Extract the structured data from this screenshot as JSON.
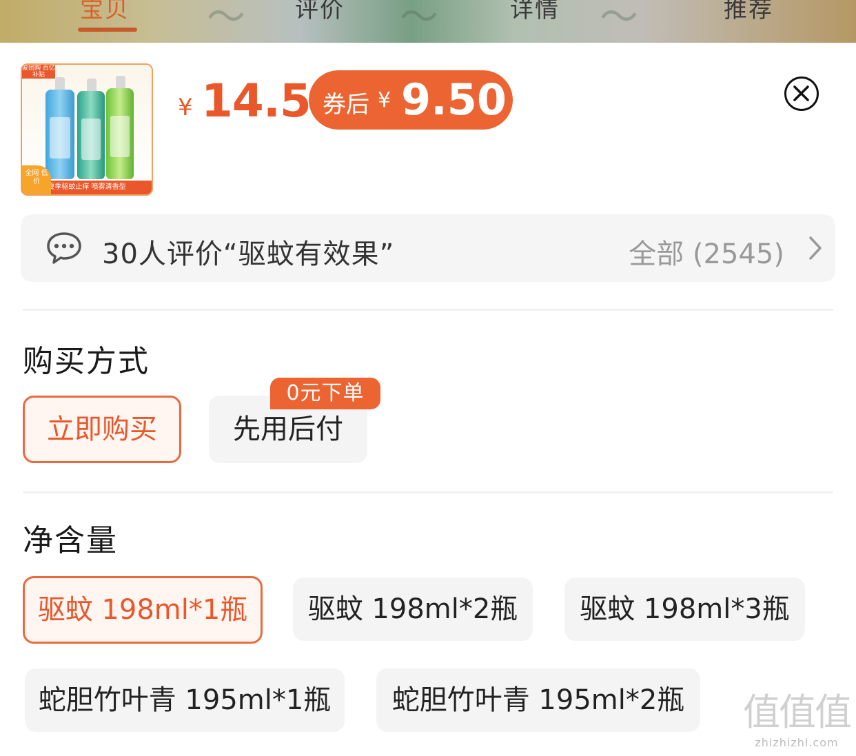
{
  "tabs": [
    {
      "label": "宝贝",
      "active": true
    },
    {
      "label": "评价",
      "active": false
    },
    {
      "label": "详情",
      "active": false
    },
    {
      "label": "推荐",
      "active": false
    }
  ],
  "product": {
    "thumb_badge": "爱团购 百亿补贴",
    "thumb_corner": "全网 低价",
    "thumb_strip": "夏季驱蚊止痒 喷雾清香型"
  },
  "price": {
    "currency": "¥",
    "value": "14.5",
    "coupon_label": "券后",
    "coupon_currency": "¥",
    "coupon_value": "9.50"
  },
  "reviews": {
    "summary": "30人评价“驱蚊有效果”",
    "all_label": "全部 (2545)"
  },
  "purchase": {
    "title": "购买方式",
    "options": [
      {
        "label": "立即购买",
        "selected": true
      },
      {
        "label": "先用后付",
        "selected": false,
        "tag": "0元下单"
      }
    ]
  },
  "volume": {
    "title": "净含量",
    "options": [
      {
        "label": "驱蚊 198ml*1瓶",
        "selected": true
      },
      {
        "label": "驱蚊 198ml*2瓶",
        "selected": false
      },
      {
        "label": "驱蚊 198ml*3瓶",
        "selected": false
      },
      {
        "label": "蛇胆竹叶青 195ml*1瓶",
        "selected": false
      },
      {
        "label": "蛇胆竹叶青 195ml*2瓶",
        "selected": false
      }
    ]
  },
  "watermark": {
    "big": "值值值",
    "small": "zhizhizhi.com"
  },
  "colors": {
    "accent": "#ec6431",
    "price": "#e9572a",
    "chip_bg": "#f4f4f4"
  }
}
